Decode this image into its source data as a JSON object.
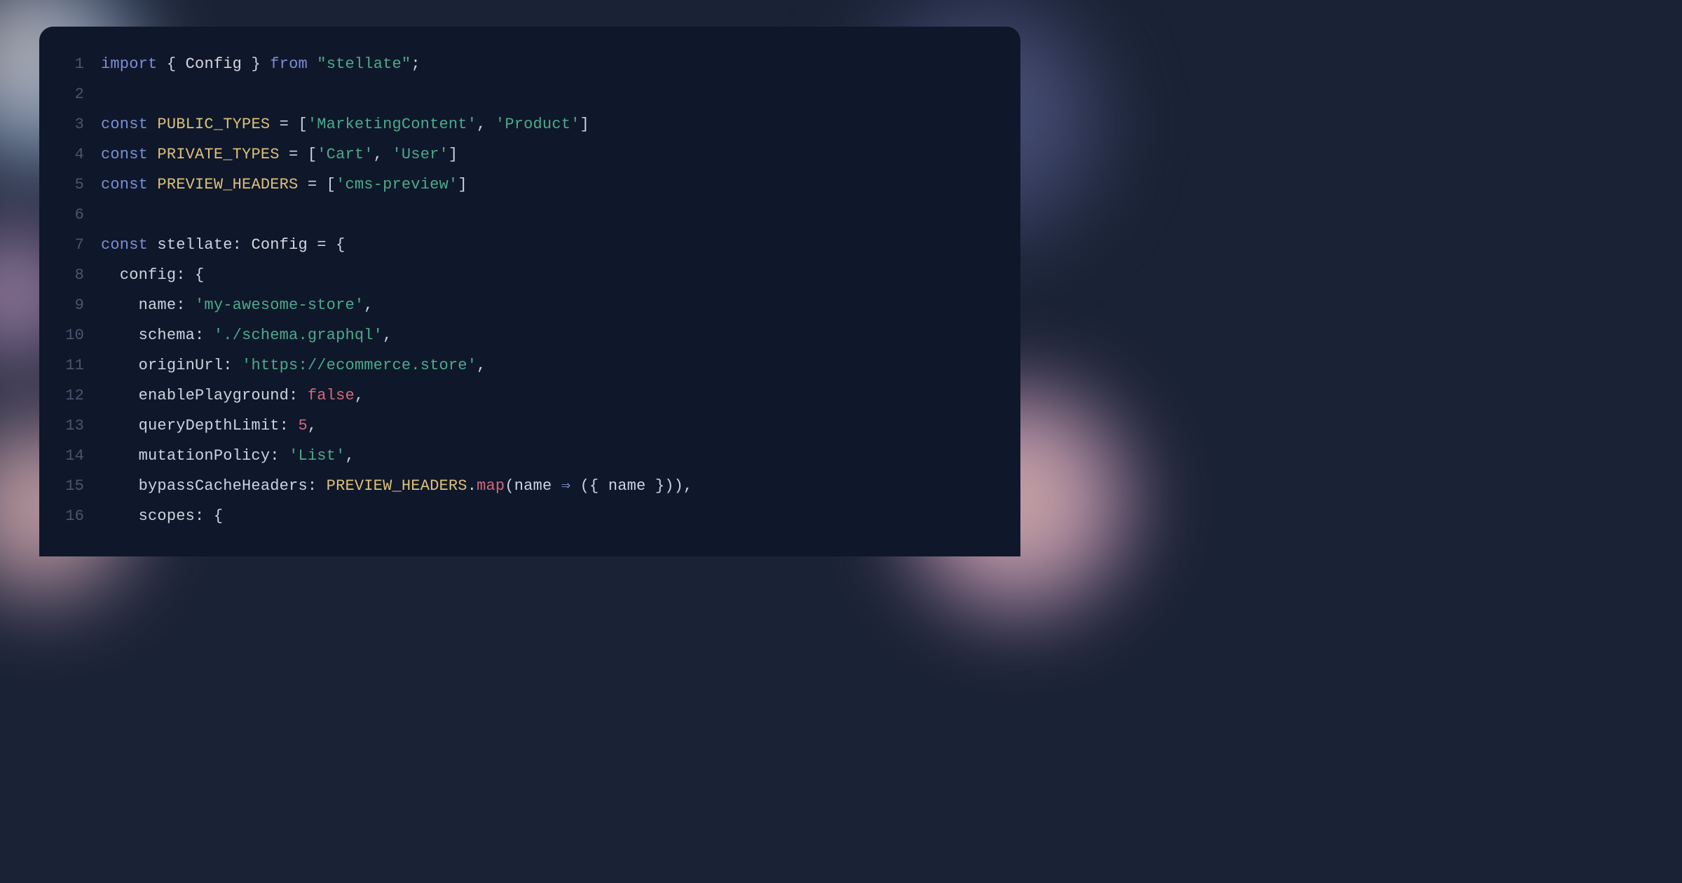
{
  "code": {
    "lines": [
      {
        "num": "1",
        "tokens": [
          [
            "kw",
            "import"
          ],
          [
            "punc",
            " { "
          ],
          [
            "type",
            "Config"
          ],
          [
            "punc",
            " } "
          ],
          [
            "kw",
            "from"
          ],
          [
            "punc",
            " "
          ],
          [
            "str",
            "\"stellate\""
          ],
          [
            "punc",
            ";"
          ]
        ]
      },
      {
        "num": "2",
        "tokens": []
      },
      {
        "num": "3",
        "tokens": [
          [
            "kw",
            "const"
          ],
          [
            "punc",
            " "
          ],
          [
            "constnm",
            "PUBLIC_TYPES"
          ],
          [
            "punc",
            " = ["
          ],
          [
            "str",
            "'MarketingContent'"
          ],
          [
            "punc",
            ", "
          ],
          [
            "str",
            "'Product'"
          ],
          [
            "punc",
            "]"
          ]
        ]
      },
      {
        "num": "4",
        "tokens": [
          [
            "kw",
            "const"
          ],
          [
            "punc",
            " "
          ],
          [
            "constnm",
            "PRIVATE_TYPES"
          ],
          [
            "punc",
            " = ["
          ],
          [
            "str",
            "'Cart'"
          ],
          [
            "punc",
            ", "
          ],
          [
            "str",
            "'User'"
          ],
          [
            "punc",
            "]"
          ]
        ]
      },
      {
        "num": "5",
        "tokens": [
          [
            "kw",
            "const"
          ],
          [
            "punc",
            " "
          ],
          [
            "constnm",
            "PREVIEW_HEADERS"
          ],
          [
            "punc",
            " = ["
          ],
          [
            "str",
            "'cms-preview'"
          ],
          [
            "punc",
            "]"
          ]
        ]
      },
      {
        "num": "6",
        "tokens": []
      },
      {
        "num": "7",
        "tokens": [
          [
            "kw",
            "const"
          ],
          [
            "punc",
            " "
          ],
          [
            "ident",
            "stellate"
          ],
          [
            "punc",
            ": "
          ],
          [
            "type",
            "Config"
          ],
          [
            "punc",
            " = {"
          ]
        ]
      },
      {
        "num": "8",
        "tokens": [
          [
            "punc",
            "  "
          ],
          [
            "prop",
            "config"
          ],
          [
            "punc",
            ": {"
          ]
        ]
      },
      {
        "num": "9",
        "tokens": [
          [
            "punc",
            "    "
          ],
          [
            "prop",
            "name"
          ],
          [
            "punc",
            ": "
          ],
          [
            "str",
            "'my-awesome-store'"
          ],
          [
            "punc",
            ","
          ]
        ]
      },
      {
        "num": "10",
        "tokens": [
          [
            "punc",
            "    "
          ],
          [
            "prop",
            "schema"
          ],
          [
            "punc",
            ": "
          ],
          [
            "str",
            "'./schema.graphql'"
          ],
          [
            "punc",
            ","
          ]
        ]
      },
      {
        "num": "11",
        "tokens": [
          [
            "punc",
            "    "
          ],
          [
            "prop",
            "originUrl"
          ],
          [
            "punc",
            ": "
          ],
          [
            "str",
            "'https://ecommerce.store'"
          ],
          [
            "punc",
            ","
          ]
        ]
      },
      {
        "num": "12",
        "tokens": [
          [
            "punc",
            "    "
          ],
          [
            "prop",
            "enablePlayground"
          ],
          [
            "punc",
            ": "
          ],
          [
            "bool",
            "false"
          ],
          [
            "punc",
            ","
          ]
        ]
      },
      {
        "num": "13",
        "tokens": [
          [
            "punc",
            "    "
          ],
          [
            "prop",
            "queryDepthLimit"
          ],
          [
            "punc",
            ": "
          ],
          [
            "num",
            "5"
          ],
          [
            "punc",
            ","
          ]
        ]
      },
      {
        "num": "14",
        "tokens": [
          [
            "punc",
            "    "
          ],
          [
            "prop",
            "mutationPolicy"
          ],
          [
            "punc",
            ": "
          ],
          [
            "str",
            "'List'"
          ],
          [
            "punc",
            ","
          ]
        ]
      },
      {
        "num": "15",
        "tokens": [
          [
            "punc",
            "    "
          ],
          [
            "prop",
            "bypassCacheHeaders"
          ],
          [
            "punc",
            ": "
          ],
          [
            "constnm",
            "PREVIEW_HEADERS"
          ],
          [
            "dot",
            "."
          ],
          [
            "method",
            "map"
          ],
          [
            "punc",
            "("
          ],
          [
            "ident",
            "name"
          ],
          [
            "punc",
            " "
          ],
          [
            "arrow",
            "⇒"
          ],
          [
            "punc",
            " ({ "
          ],
          [
            "ident",
            "name"
          ],
          [
            "punc",
            " })),"
          ]
        ]
      },
      {
        "num": "16",
        "tokens": [
          [
            "punc",
            "    "
          ],
          [
            "prop",
            "scopes"
          ],
          [
            "punc",
            ": {"
          ]
        ]
      }
    ]
  }
}
